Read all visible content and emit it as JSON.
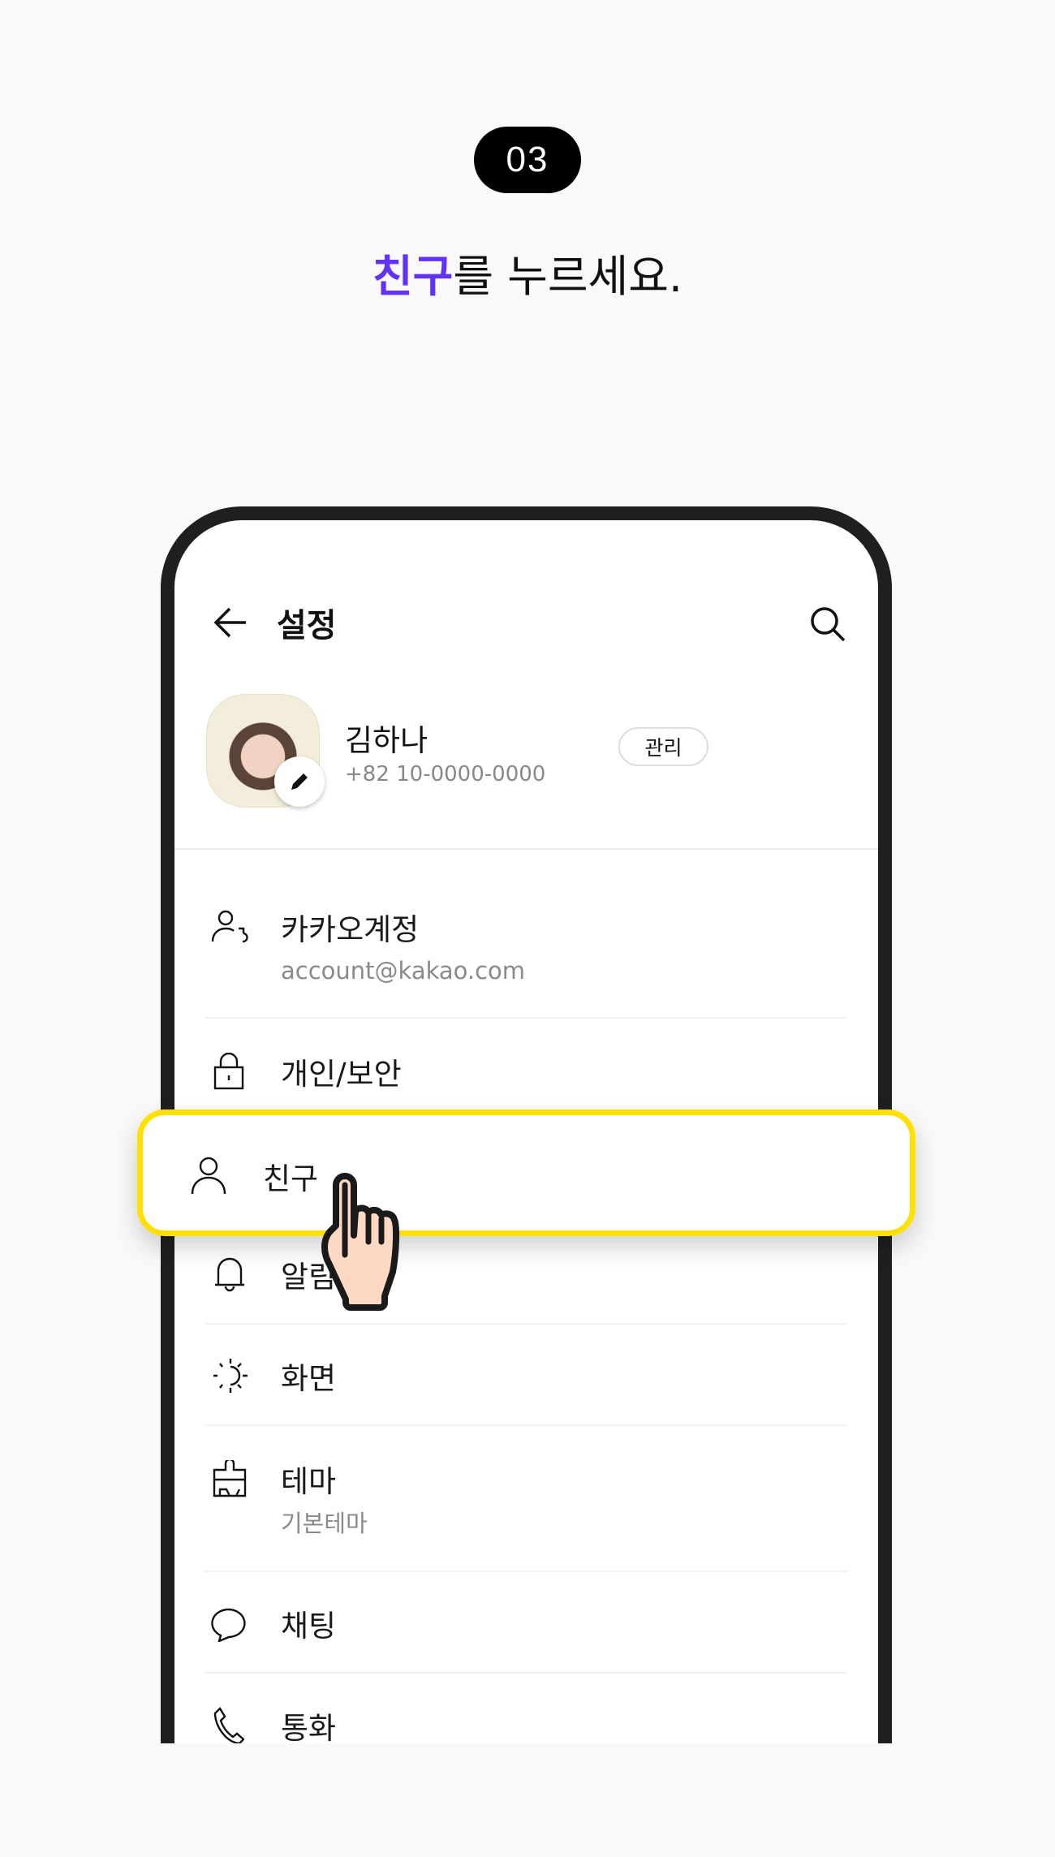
{
  "step": {
    "number": "03"
  },
  "headline": {
    "highlight": "친구",
    "rest": "를 누르세요."
  },
  "colors": {
    "accent": "#6233f5",
    "highlight_border": "#ffe000",
    "frame": "#1f1f1f"
  },
  "header": {
    "back_icon": "arrow-left-icon",
    "title": "설정",
    "search_icon": "search-icon"
  },
  "profile": {
    "name": "김하나",
    "phone": "+82 10-0000-0000",
    "manage_label": "관리",
    "edit_icon": "pencil-icon"
  },
  "menu": [
    {
      "label": "카카오계정",
      "sub": "account@kakao.com",
      "icon": "account-icon"
    },
    {
      "label": "개인/보안",
      "icon": "lock-icon"
    },
    {
      "label": "친구",
      "icon": "person-icon",
      "highlighted": true
    },
    {
      "label": "알림",
      "icon": "bell-icon"
    },
    {
      "label": "화면",
      "icon": "sun-icon"
    },
    {
      "label": "테마",
      "sub": "기본테마",
      "icon": "paint-brush-icon"
    },
    {
      "label": "채팅",
      "icon": "chat-bubble-icon"
    },
    {
      "label": "통화",
      "icon": "phone-icon"
    }
  ],
  "pointer": {
    "icon": "pointing-hand-icon"
  }
}
